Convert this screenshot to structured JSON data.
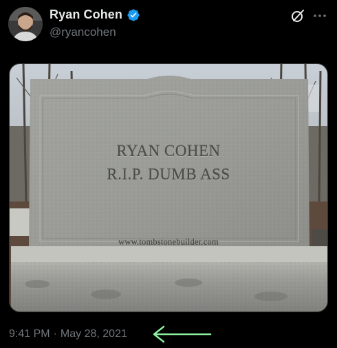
{
  "tweet": {
    "author": {
      "display_name": "Ryan Cohen",
      "handle": "@ryancohen",
      "verified": true,
      "avatar_icon": "avatar-photo"
    },
    "header_actions": {
      "grok_icon": "grok-icon",
      "more_icon": "more-icon"
    },
    "media": {
      "tombstone_line1": "RYAN COHEN",
      "tombstone_line2": "R.I.P. DUMB ASS",
      "watermark": "www.tombstonebuilder.com"
    },
    "time": "9:41 PM",
    "separator": "·",
    "date": "May 28, 2021"
  },
  "annotation": {
    "arrow_color": "#8cf0a0",
    "arrow_direction": "left"
  },
  "colors": {
    "background": "#000000",
    "primary_text": "#e7e9ea",
    "secondary_text": "#71767b",
    "verified_blue": "#1d9bf0"
  }
}
